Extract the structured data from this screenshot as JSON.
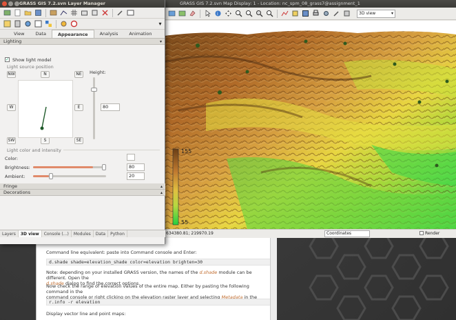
{
  "layer_manager": {
    "title": "GRASS GIS 7.2.svn Layer Manager",
    "tabs": [
      "View",
      "Data",
      "Appearance",
      "Analysis",
      "Animation"
    ],
    "active_tab": "Appearance",
    "lighting": {
      "section_label": "Lighting",
      "show_light_model_label": "Show light model",
      "show_light_model_checked": true,
      "light_source_position_label": "Light source position",
      "dirs": {
        "nw": "NW",
        "n": "N",
        "ne": "NE",
        "w": "W",
        "e": "E",
        "sw": "SW",
        "s": "S",
        "se": "SE"
      },
      "height_label": "Height:",
      "height_value": "80",
      "light_color_intensity_label": "Light color and intensity",
      "color_label": "Color:",
      "brightness_label": "Brightness:",
      "brightness_value": "80",
      "ambient_label": "Ambient:",
      "ambient_value": "20"
    },
    "fringe_label": "Fringe",
    "decorations_label": "Decorations",
    "bottom_tabs": [
      "Layers",
      "3D view",
      "Console (...)",
      "Modules",
      "Data",
      "Python"
    ],
    "active_bottom_tab": "3D view"
  },
  "map_display": {
    "title": "GRASS GIS 7.2.svn Map Display: 1 - Location: nc_spm_08_grass7@assignment_1",
    "view_mode": "3D view",
    "coordinates_readout": "634380.81; 219970.19",
    "coordinates_mode": "Coordinates",
    "render_label": "Render",
    "legend_top": "155",
    "legend_bottom": "55"
  },
  "tutorial": {
    "p1": "Command line equivalent: paste into Command console and Enter:",
    "code1": "d.shade shade=elevation_shade color=elevation brighten=30",
    "p2a": "Note: depending on your installed GRASS version, the names of the ",
    "p2_link1": "d.shade",
    "p2b": " module can be different. Open the",
    "p2c_link": "d.shade",
    "p2d": " dialog to find the correct options.",
    "p3a": "Now check the range of elevation values of the entire map. Either by pasting the following command in the",
    "p3b": "command console or right clicking on the elevation raster layer and selecting ",
    "p3_link": "Metadata",
    "p3c": " in the context menu.",
    "code2": "r.info -r elevation",
    "p4": "Display vector line and point maps:"
  },
  "colors": {
    "accent_orange": "#e08a6a",
    "titlebar": "#3c3b37"
  }
}
